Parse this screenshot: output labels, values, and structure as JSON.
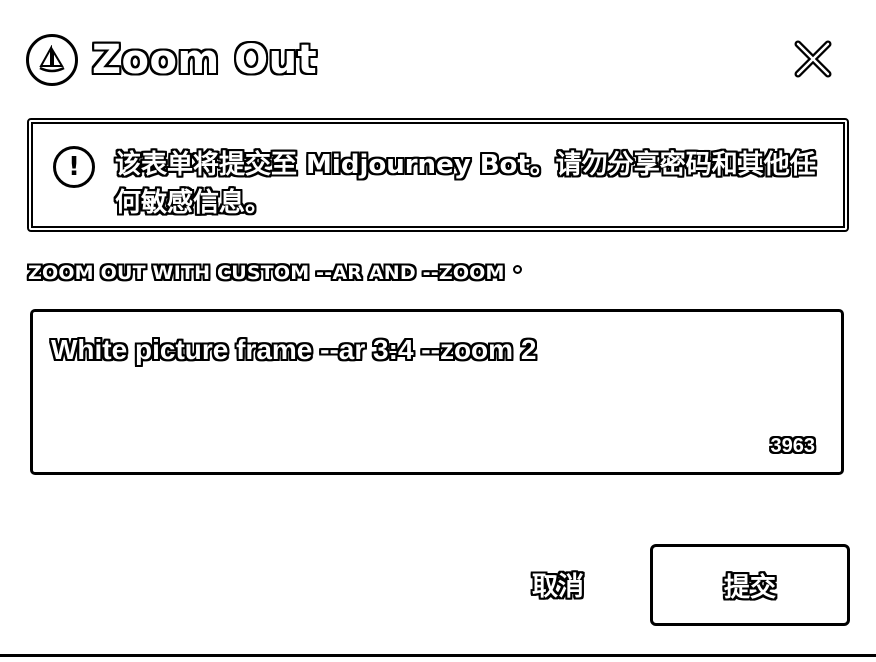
{
  "dialog": {
    "title": "Zoom Out",
    "icons": {
      "app": "midjourney-boat-icon",
      "close": "close-icon",
      "warning": "exclamation-icon",
      "info": "info-dot-icon"
    }
  },
  "warning": {
    "text": "该表单将提交至 Midjourney Bot。请勿分享密码和其他任何敏感信息。"
  },
  "prompt_field": {
    "label": "ZOOM OUT WITH CUSTOM --AR AND --ZOOM",
    "value": "White picture frame --ar 3:4 --zoom 2",
    "remaining_chars": "3963"
  },
  "actions": {
    "cancel_label": "取消",
    "submit_label": "提交"
  }
}
